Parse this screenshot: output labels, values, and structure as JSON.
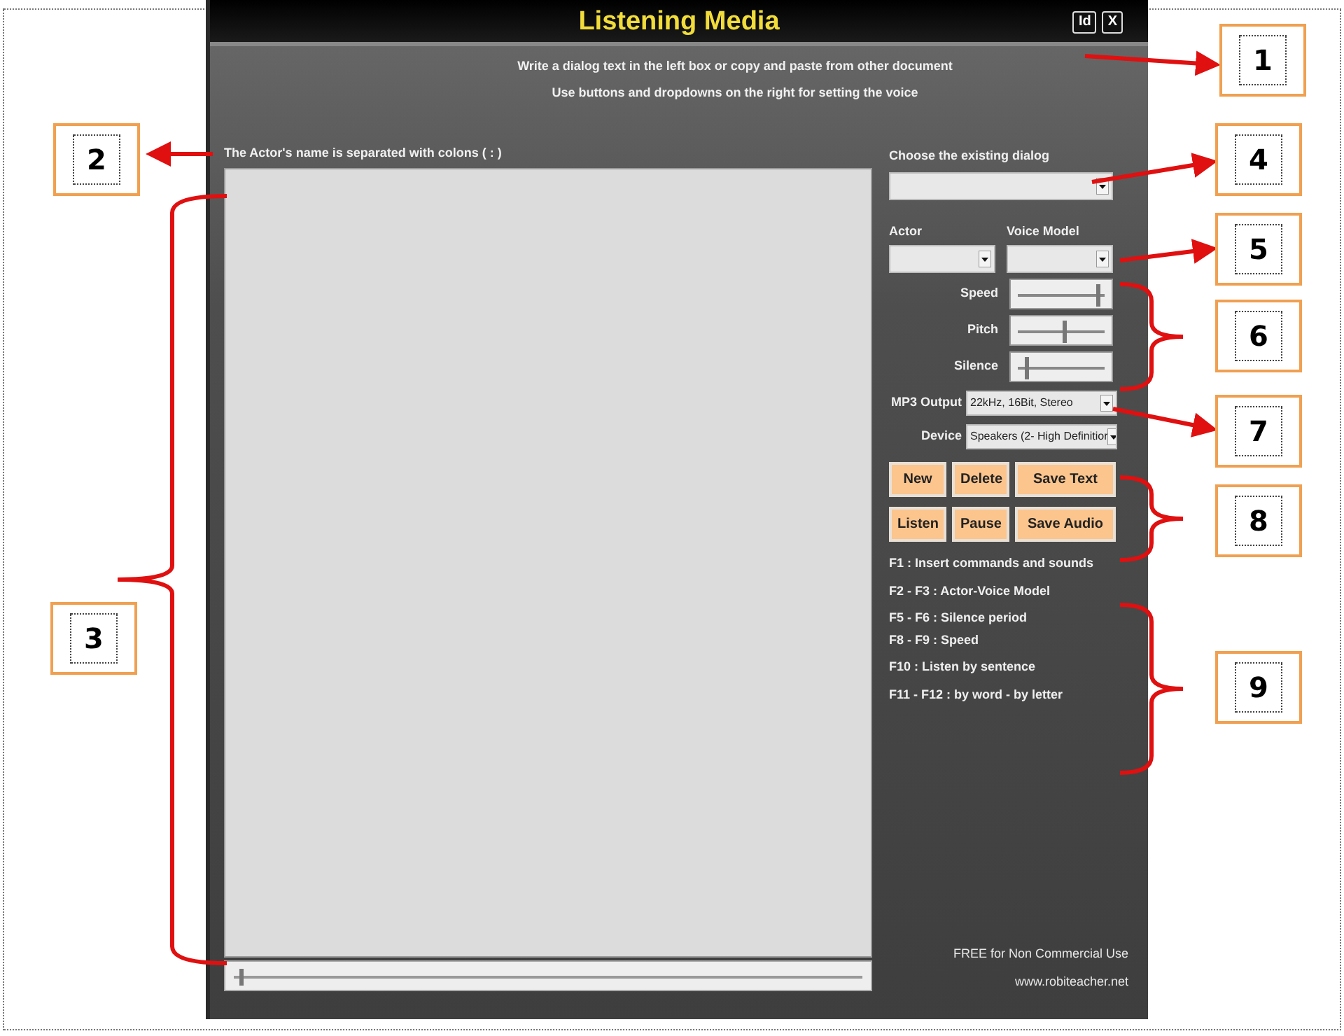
{
  "window": {
    "title": "Listening Media",
    "title_buttons": [
      "Id",
      "X"
    ]
  },
  "instructions": [
    "Write a dialog text in the left box or copy and paste from other document",
    "Use buttons and dropdowns on the right for setting the voice"
  ],
  "editor": {
    "label": "The Actor's name is separated with colons ( : )",
    "position": {
      "level": 0.01
    }
  },
  "dialog_select": {
    "label": "Choose the existing dialog"
  },
  "actor": {
    "label": "Actor"
  },
  "voice_model": {
    "label": "Voice Model"
  },
  "sliders": [
    {
      "label": "Speed",
      "level": 0.95
    },
    {
      "label": "Pitch",
      "level": 0.55
    },
    {
      "label": "Silence",
      "level": 0.08
    }
  ],
  "dropdowns": [
    {
      "label": "MP3 Output",
      "value": "22kHz, 16Bit, Stereo"
    },
    {
      "label": "Device",
      "value": "Speakers (2- High Definitior"
    }
  ],
  "buttons": [
    [
      "New",
      "Delete",
      "Save Text"
    ],
    [
      "Listen",
      "Pause",
      "Save Audio"
    ]
  ],
  "shortcuts": [
    "F1 : Insert commands and sounds",
    "F2 - F3 : Actor-Voice Model",
    "F5 - F6 : Silence period",
    "F8 - F9 : Speed",
    "F10 : Listen by sentence",
    "F11 - F12 : by word - by letter"
  ],
  "footer": [
    "FREE for Non Commercial Use",
    "www.robiteacher.net"
  ],
  "callouts": [
    {
      "label": "1",
      "kind": "arrow"
    },
    {
      "label": "2",
      "kind": "arrow"
    },
    {
      "label": "4",
      "kind": "arrow"
    },
    {
      "label": "5",
      "kind": "arrow"
    },
    {
      "label": "6",
      "kind": "brace"
    },
    {
      "label": "7",
      "kind": "arrow"
    },
    {
      "label": "8",
      "kind": "brace"
    },
    {
      "label": "3",
      "kind": "brace"
    },
    {
      "label": "9",
      "kind": "brace"
    }
  ]
}
